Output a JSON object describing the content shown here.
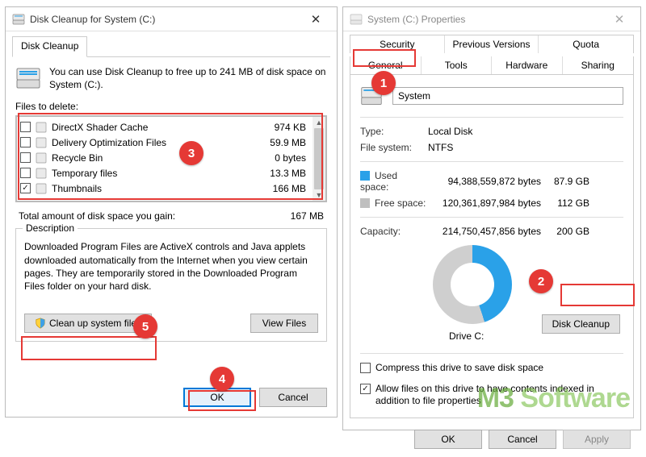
{
  "leftWindow": {
    "title": "Disk Cleanup for System (C:)",
    "tab": "Disk Cleanup",
    "intro": "You can use Disk Cleanup to free up to 241 MB of disk space on System (C:).",
    "filesLabel": "Files to delete:",
    "files": [
      {
        "name": "DirectX Shader Cache",
        "size": "974 KB",
        "checked": false
      },
      {
        "name": "Delivery Optimization Files",
        "size": "59.9 MB",
        "checked": false
      },
      {
        "name": "Recycle Bin",
        "size": "0 bytes",
        "checked": false
      },
      {
        "name": "Temporary files",
        "size": "13.3 MB",
        "checked": false
      },
      {
        "name": "Thumbnails",
        "size": "166 MB",
        "checked": true
      }
    ],
    "totalLabel": "Total amount of disk space you gain:",
    "totalValue": "167 MB",
    "descLegend": "Description",
    "descText": "Downloaded Program Files are ActiveX controls and Java applets downloaded automatically from the Internet when you view certain pages. They are temporarily stored in the Downloaded Program Files folder on your hard disk.",
    "cleanSystemBtn": "Clean up system files",
    "viewFilesBtn": "View Files",
    "ok": "OK",
    "cancel": "Cancel"
  },
  "rightWindow": {
    "title": "System (C:) Properties",
    "tabsTop": [
      "Security",
      "Previous Versions",
      "Quota"
    ],
    "tabsBottom": [
      "General",
      "Tools",
      "Hardware",
      "Sharing"
    ],
    "activeTab": "General",
    "nameValue": "System",
    "typeLabel": "Type:",
    "typeValue": "Local Disk",
    "fsLabel": "File system:",
    "fsValue": "NTFS",
    "usedLabel": "Used space:",
    "usedBytes": "94,388,559,872 bytes",
    "usedGb": "87.9 GB",
    "freeLabel": "Free space:",
    "freeBytes": "120,361,897,984 bytes",
    "freeGb": "112 GB",
    "capLabel": "Capacity:",
    "capBytes": "214,750,457,856 bytes",
    "capGb": "200 GB",
    "driveLabel": "Drive C:",
    "diskCleanupBtn": "Disk Cleanup",
    "compressLabel": "Compress this drive to save disk space",
    "indexLabel": "Allow files on this drive to have contents indexed in addition to file properties",
    "ok": "OK",
    "cancel": "Cancel",
    "apply": "Apply"
  },
  "watermark": "M3 Software"
}
